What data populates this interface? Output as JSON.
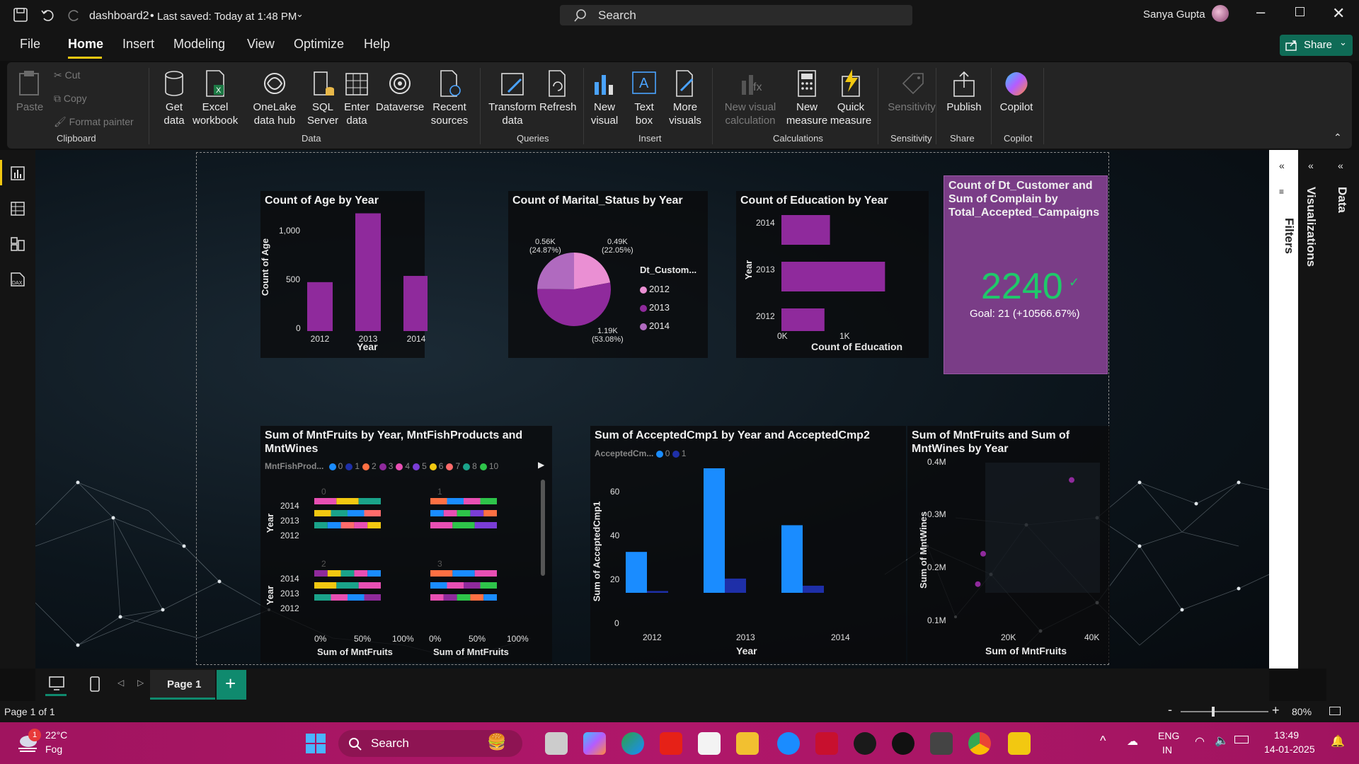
{
  "title_bar": {
    "file_name": "dashboard2",
    "saved_status": "Last saved: Today at 1:48 PM",
    "search_placeholder": "Search",
    "user_name": "Sanya Gupta"
  },
  "menu": {
    "file": "File",
    "tabs": [
      "Home",
      "Insert",
      "Modeling",
      "View",
      "Optimize",
      "Help"
    ],
    "share": "Share"
  },
  "ribbon": {
    "clipboard": {
      "paste": "Paste",
      "cut": "Cut",
      "copy": "Copy",
      "format_painter": "Format painter",
      "group": "Clipboard"
    },
    "data": {
      "get_data": "Get data",
      "excel": "Excel workbook",
      "onelake": "OneLake data hub",
      "sql": "SQL Server",
      "enter": "Enter data",
      "dataverse": "Dataverse",
      "recent": "Recent sources",
      "group": "Data"
    },
    "queries": {
      "transform": "Transform data",
      "refresh": "Refresh",
      "group": "Queries"
    },
    "insert": {
      "new_visual": "New visual",
      "text_box": "Text box",
      "more_visuals": "More visuals",
      "group": "Insert"
    },
    "calculations": {
      "new_visual_calc": "New visual calculation",
      "new_measure": "New measure",
      "quick_measure": "Quick measure",
      "group": "Calculations"
    },
    "sensitivity": {
      "label": "Sensitivity",
      "group": "Sensitivity"
    },
    "share": {
      "publish": "Publish",
      "group": "Share"
    },
    "copilot": {
      "label": "Copilot",
      "group": "Copilot"
    }
  },
  "side_panels": {
    "filters": "Filters",
    "visualizations": "Visualizations",
    "data": "Data"
  },
  "visuals": {
    "age": {
      "title": "Count of Age by Year",
      "xlabel": "Year",
      "ylabel": "Count of Age",
      "yticks": [
        "1,000",
        "500",
        "0"
      ]
    },
    "marital": {
      "title": "Count of Marital_Status by Year",
      "legend_title": "Dt_Custom...",
      "labels": [
        {
          "value": "0.56K",
          "pct": "(24.87%)"
        },
        {
          "value": "0.49K",
          "pct": "(22.05%)"
        },
        {
          "value": "1.19K",
          "pct": "(53.08%)"
        }
      ]
    },
    "education": {
      "title": "Count of Education by Year",
      "xlabel": "Count of Education",
      "ylabel": "Year",
      "xticks": [
        "0K",
        "1K"
      ]
    },
    "kpi": {
      "title": "Count of Dt_Customer and Sum of Complain by Total_Accepted_Campaigns",
      "value": "2240",
      "goal": "Goal: 21 (+10566.67%)"
    },
    "fruits_small": {
      "title": "Sum of MntFruits by Year, MntFishProducts and MntWines",
      "legend_title": "MntFishProd...",
      "legend": [
        "0",
        "1",
        "2",
        "3",
        "4",
        "5",
        "6",
        "7",
        "8",
        "10"
      ],
      "ylabel": "Year",
      "xlabel": "Sum of MntFruits",
      "xticks": [
        "0%",
        "50%",
        "100%"
      ],
      "panel_labels": [
        "0",
        "1",
        "2",
        "3"
      ]
    },
    "accepted": {
      "title": "Sum of AcceptedCmp1 by Year and AcceptedCmp2",
      "legend_title": "AcceptedCm...",
      "legend": [
        "0",
        "1"
      ],
      "xlabel": "Year",
      "ylabel": "Sum of AcceptedCmp1",
      "yticks": [
        "60",
        "40",
        "20",
        "0"
      ]
    },
    "scatter": {
      "title": "Sum of MntFruits and Sum of MntWines by Year",
      "xlabel": "Sum of MntFruits",
      "ylabel": "Sum of MntWines",
      "xticks": [
        "20K",
        "40K"
      ],
      "yticks": [
        "0.4M",
        "0.3M",
        "0.2M",
        "0.1M"
      ]
    }
  },
  "chart_data": [
    {
      "type": "bar",
      "title": "Count of Age by Year",
      "categories": [
        "2012",
        "2013",
        "2014"
      ],
      "values": [
        494,
        1189,
        557
      ],
      "ylim": [
        0,
        1200
      ],
      "xlabel": "Year",
      "ylabel": "Count of Age",
      "color": "#8f2a9c"
    },
    {
      "type": "pie",
      "title": "Count of Marital_Status by Year",
      "categories": [
        "2012",
        "2013",
        "2014"
      ],
      "values": [
        494,
        1189,
        557
      ],
      "colors": [
        "#ea8fd3",
        "#8f2a9c",
        "#b06abf"
      ]
    },
    {
      "type": "bar",
      "orientation": "horizontal",
      "title": "Count of Education by Year",
      "categories": [
        "2014",
        "2013",
        "2012"
      ],
      "values": [
        557,
        1189,
        494
      ],
      "xlim": [
        0,
        1300
      ],
      "xlabel": "Count of Education",
      "ylabel": "Year",
      "color": "#8f2a9c"
    },
    {
      "type": "bar",
      "title": "Sum of AcceptedCmp1 by Year and AcceptedCmp2",
      "categories": [
        "2012",
        "2013",
        "2014"
      ],
      "series": [
        {
          "name": "0",
          "values": [
            23,
            70,
            38
          ],
          "color": "#1a8cff"
        },
        {
          "name": "1",
          "values": [
            1,
            8,
            4
          ],
          "color": "#1e2fa8"
        }
      ],
      "ylim": [
        0,
        70
      ],
      "xlabel": "Year",
      "ylabel": "Sum of AcceptedCmp1"
    },
    {
      "type": "scatter",
      "title": "Sum of MntFruits and Sum of MntWines by Year",
      "points": [
        {
          "x": 5500,
          "y": 0.12
        },
        {
          "x": 7000,
          "y": 0.19
        },
        {
          "x": 32000,
          "y": 0.36
        }
      ],
      "xlim": [
        0,
        40000
      ],
      "ylim": [
        0.1,
        0.4
      ],
      "xlabel": "Sum of MntFruits",
      "ylabel": "Sum of MntWines",
      "color": "#8f2a9c"
    }
  ],
  "pages": {
    "tab": "Page 1",
    "status": "Page 1 of 1",
    "zoom": "80%"
  },
  "taskbar": {
    "temp": "22°C",
    "weather": "Fog",
    "search": "Search",
    "lang1": "ENG",
    "lang2": "IN",
    "time": "13:49",
    "date": "14-01-2025",
    "notif": "1"
  }
}
